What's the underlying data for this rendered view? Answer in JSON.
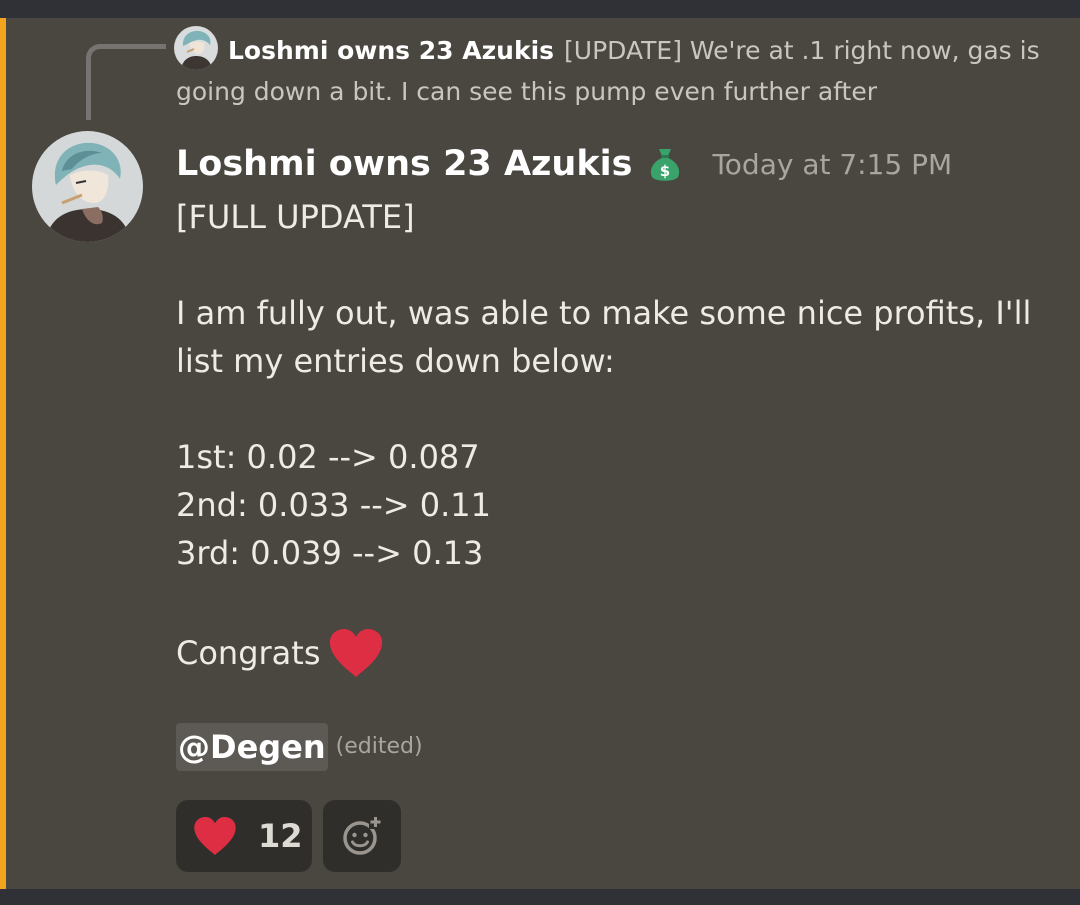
{
  "reply": {
    "author": "Loshmi owns 23 Azukis",
    "text": "[UPDATE]  We're at .1 right now, gas is going down a bit. I can see this pump even further after"
  },
  "message": {
    "author": "Loshmi owns 23 Azukis",
    "badge_icon": "money-bag-icon",
    "timestamp": "Today at 7:15 PM",
    "lines": {
      "l1": "[FULL UPDATE]",
      "l2": "I am fully out, was able to make some nice profits, I'll",
      "l3": "list my entries down below:",
      "l4": "1st: 0.02 --> 0.087",
      "l5": "2nd: 0.033 --> 0.11",
      "l6": "3rd: 0.039 --> 0.13",
      "l7": "Congrats"
    },
    "mention": "@Degen",
    "edited": "(edited)"
  },
  "reactions": [
    {
      "emoji": "red-heart-icon",
      "count": "12"
    }
  ],
  "colors": {
    "accent": "#f2a51d",
    "background": "#4a4640",
    "heart": "#dd2e44",
    "money_bag": "#2e8b57"
  }
}
